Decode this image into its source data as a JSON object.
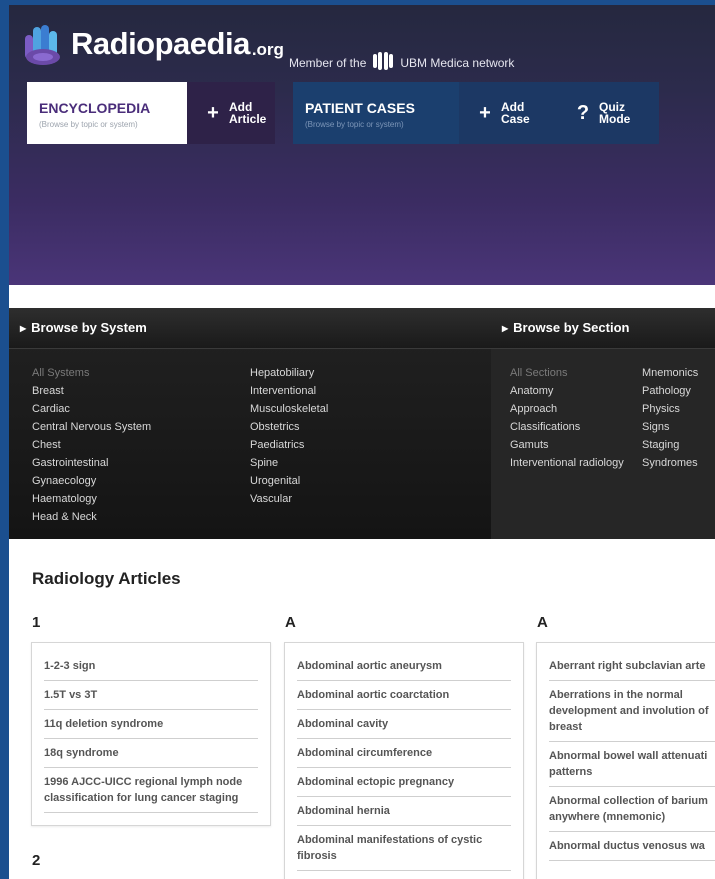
{
  "header": {
    "logo_text": "Radiopaedia",
    "logo_tld": ".org",
    "member_prefix": "Member of the",
    "member_network": "UBM Medica network"
  },
  "nav": {
    "encyclopedia": {
      "title": "ENCYCLOPEDIA",
      "subtitle": "(Browse by topic or system)"
    },
    "add_article": {
      "icon": "+",
      "label": "Add Article"
    },
    "patient_cases": {
      "title": "PATIENT CASES",
      "subtitle": "(Browse by topic or system)"
    },
    "add_case": {
      "icon": "+",
      "label": "Add Case"
    },
    "quiz_mode": {
      "icon": "?",
      "label": "Quiz Mode"
    }
  },
  "browse_system": {
    "heading": "Browse by System",
    "col1": [
      "All Systems",
      "Breast",
      "Cardiac",
      "Central Nervous System",
      "Chest",
      "Gastrointestinal",
      "Gynaecology",
      "Haematology",
      "Head & Neck"
    ],
    "col2": [
      "Hepatobiliary",
      "Interventional",
      "Musculoskeletal",
      "Obstetrics",
      "Paediatrics",
      "Spine",
      "Urogenital",
      "Vascular"
    ]
  },
  "browse_section": {
    "heading": "Browse by Section",
    "col1": [
      "All Sections",
      "Anatomy",
      "Approach",
      "Classifications",
      "Gamuts",
      "Interventional radiology"
    ],
    "col2": [
      "Mnemonics",
      "Pathology",
      "Physics",
      "Signs",
      "Staging",
      "Syndromes"
    ]
  },
  "articles": {
    "title": "Radiology Articles",
    "groups": [
      {
        "letter": "1",
        "items": [
          "1-2-3 sign",
          "1.5T vs 3T",
          "11q deletion syndrome",
          "18q syndrome",
          "1996 AJCC-UICC regional lymph node classification for lung cancer staging"
        ]
      },
      {
        "letter": "A",
        "items": [
          "Abdominal aortic aneurysm",
          "Abdominal aortic coarctation",
          "Abdominal cavity",
          "Abdominal circumference",
          "Abdominal ectopic pregnancy",
          "Abdominal hernia",
          "Abdominal manifestations of cystic fibrosis"
        ]
      },
      {
        "letter": "A",
        "items": [
          "Aberrant right subclavian arte",
          "Aberrations in the normal development and involution of breast",
          "Abnormal bowel wall attenuati patterns",
          "Abnormal collection of barium anywhere (mnemonic)",
          "Abnormal ductus venosus wa"
        ]
      }
    ],
    "next_letter": "2"
  }
}
